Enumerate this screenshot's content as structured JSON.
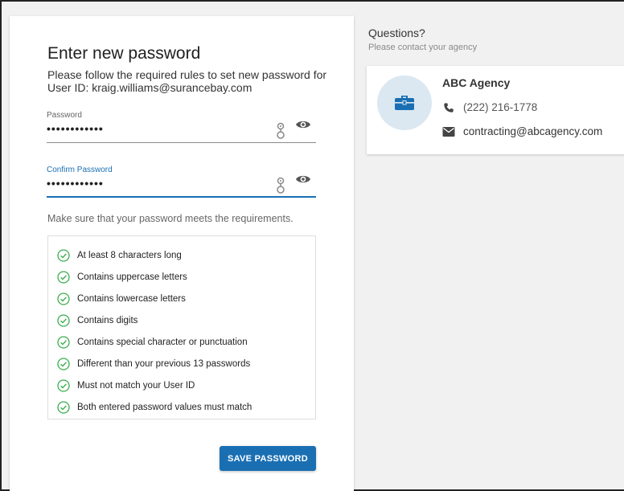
{
  "form": {
    "title": "Enter new password",
    "intro_line1": "Please follow the required rules to set new password for",
    "intro_line2": "User ID:  kraig.williams@surancebay.com",
    "password": {
      "label": "Password",
      "value": "••••••••••••"
    },
    "confirm": {
      "label": "Confirm Password",
      "value": "••••••••••••"
    },
    "hint": "Make sure that your password meets the requirements.",
    "requirements": [
      "At least 8 characters long",
      "Contains uppercase letters",
      "Contains lowercase letters",
      "Contains digits",
      "Contains special character or punctuation",
      "Different than your previous 13 passwords",
      "Must not match your User ID",
      "Both entered password values must match"
    ],
    "save_label": "SAVE PASSWORD"
  },
  "sidebar": {
    "questions": "Questions?",
    "contact_note": "Please contact your agency",
    "agency": {
      "name": "ABC Agency",
      "phone": "(222) 216-1778",
      "email": "contracting@abcagency.com"
    }
  },
  "colors": {
    "accent": "#1a6fb3",
    "check": "#3cae4f",
    "avatar_bg": "#dbe8f2"
  },
  "icons": [
    "key-icon",
    "eye-icon",
    "check-circle-icon",
    "briefcase-icon",
    "phone-icon",
    "email-icon"
  ]
}
